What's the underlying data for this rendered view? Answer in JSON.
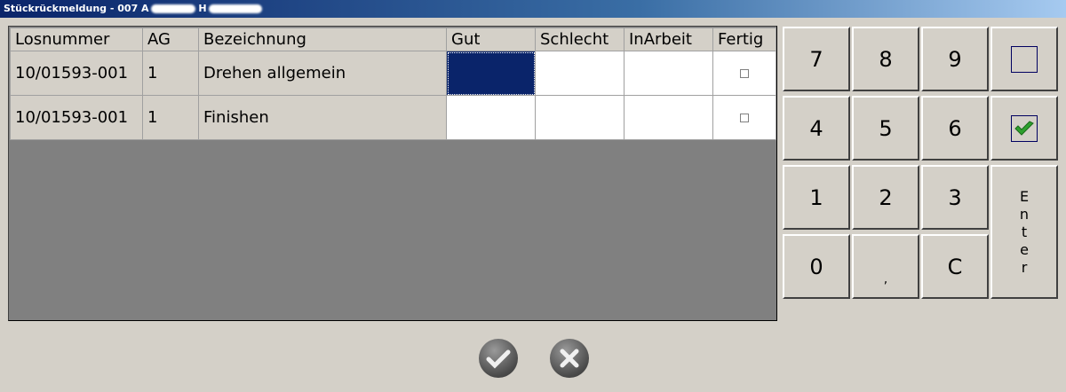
{
  "window": {
    "title": "Stückrückmeldung - 007 A",
    "title_suffix": "H"
  },
  "table": {
    "headers": [
      "Losnummer",
      "AG",
      "Bezeichnung",
      "Gut",
      "Schlecht",
      "InArbeit",
      "Fertig"
    ],
    "rows": [
      {
        "losnummer": "10/01593-001",
        "ag": "1",
        "bezeichnung": "Drehen allgemein",
        "gut": "",
        "schlecht": "",
        "inarbeit": "",
        "fertig": false
      },
      {
        "losnummer": "10/01593-001",
        "ag": "1",
        "bezeichnung": "Finishen",
        "gut": "",
        "schlecht": "",
        "inarbeit": "",
        "fertig": false
      }
    ]
  },
  "keypad": {
    "keys": [
      "7",
      "8",
      "9",
      "4",
      "5",
      "6",
      "1",
      "2",
      "3",
      "0",
      ",",
      "C"
    ],
    "enter": [
      "E",
      "n",
      "t",
      "e",
      "r"
    ]
  },
  "colors": {
    "selection": "#0a246a",
    "check": "#2ea02e"
  }
}
